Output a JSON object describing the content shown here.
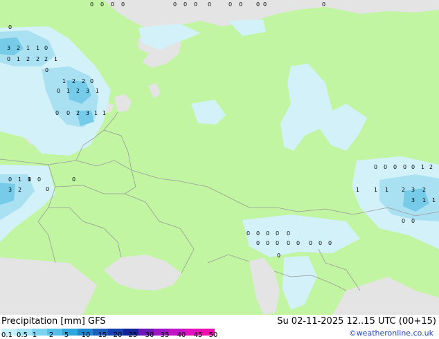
{
  "header": {
    "title": "Precipitation [mm]  GFS",
    "valid_time": "Su 02-11-2025 12..15 UTC (00+15)",
    "credit": "©weatheronline.co.uk"
  },
  "legend": {
    "labels": [
      "0.1",
      "0.5",
      "1",
      "2",
      "5",
      "10",
      "15",
      "20",
      "25",
      "30",
      "35",
      "40",
      "45",
      "50"
    ],
    "colors": [
      "#c8f0fa",
      "#a6e4f5",
      "#7cd3ee",
      "#54bfe6",
      "#2ea6de",
      "#1c87cf",
      "#1a5fbf",
      "#183fae",
      "#12239a",
      "#6a18b8",
      "#9e16c6",
      "#c414c8",
      "#e012c0",
      "#f20fb2"
    ]
  },
  "palette": {
    "land": "#c1f5a2",
    "sea": "#e4e4e4",
    "precip_light": "#d2f1f9",
    "precip_med": "#a9e1f2",
    "precip_heavy": "#76cbe9",
    "border": "#9a9a9a",
    "label": "#000000"
  },
  "map_labels": {
    "row_top": [
      "0",
      "0",
      "0",
      "0",
      "0",
      "0",
      "0",
      "0",
      "0",
      "0",
      "0",
      "0",
      "0"
    ],
    "nw_block": [
      "0",
      "3",
      "2",
      "1",
      "1",
      "0",
      "0",
      "1",
      "2",
      "2",
      "2",
      "1"
    ],
    "baltic": [
      "0",
      "1",
      "2",
      "2",
      "0",
      "0",
      "1",
      "2",
      "3",
      "1",
      "0",
      "0",
      "2",
      "3",
      "1",
      "1"
    ],
    "west": [
      "0",
      "1",
      "0",
      "0",
      "3",
      "2",
      "0",
      "1",
      "0"
    ],
    "east_block": [
      "0",
      "0",
      "0",
      "0",
      "0",
      "1",
      "2",
      "1",
      "1",
      "1",
      "2",
      "3",
      "2",
      "3",
      "1",
      "1",
      "0",
      "0"
    ],
    "south": [
      "0",
      "0",
      "0",
      "0",
      "0",
      "0",
      "0",
      "0",
      "0",
      "0",
      "0",
      "0",
      "0",
      "0"
    ]
  }
}
